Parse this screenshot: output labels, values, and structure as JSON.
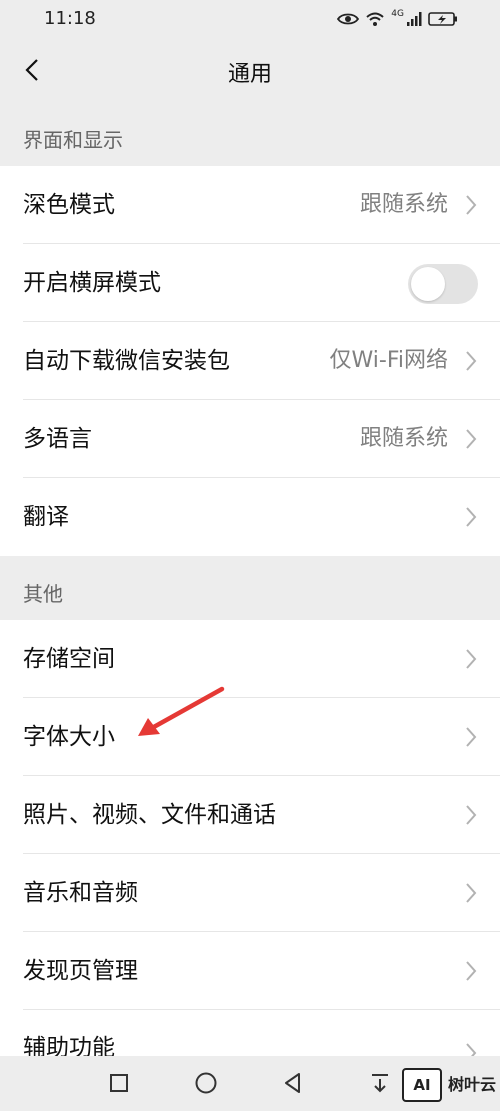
{
  "status_bar": {
    "time": "11:18",
    "network_label": "4G"
  },
  "header": {
    "title": "通用"
  },
  "sections": [
    {
      "label": "界面和显示",
      "rows": [
        {
          "label": "深色模式",
          "value": "跟随系统",
          "control": "chevron"
        },
        {
          "label": "开启横屏模式",
          "value": "",
          "control": "toggle",
          "toggle_on": false
        },
        {
          "label": "自动下载微信安装包",
          "value": "仅Wi-Fi网络",
          "control": "chevron"
        },
        {
          "label": "多语言",
          "value": "跟随系统",
          "control": "chevron"
        },
        {
          "label": "翻译",
          "value": "",
          "control": "chevron"
        }
      ]
    },
    {
      "label": "其他",
      "rows": [
        {
          "label": "存储空间",
          "value": "",
          "control": "chevron"
        },
        {
          "label": "字体大小",
          "value": "",
          "control": "chevron"
        },
        {
          "label": "照片、视频、文件和通话",
          "value": "",
          "control": "chevron"
        },
        {
          "label": "音乐和音频",
          "value": "",
          "control": "chevron"
        },
        {
          "label": "发现页管理",
          "value": "",
          "control": "chevron"
        }
      ]
    }
  ],
  "partial_row": {
    "label": "辅助功能"
  },
  "watermark": {
    "logo_text": "AI",
    "text": "树叶云"
  },
  "colors": {
    "background": "#ededed",
    "card": "#ffffff",
    "annotation_arrow": "#e53935",
    "secondary_text": "#808080"
  },
  "icons": {
    "back": "chevron-left-icon",
    "row_control": "chevron-right-icon",
    "nav_recents": "square-icon",
    "nav_home": "circle-icon",
    "nav_back": "triangle-back-icon",
    "nav_extra": "pull-down-icon"
  }
}
